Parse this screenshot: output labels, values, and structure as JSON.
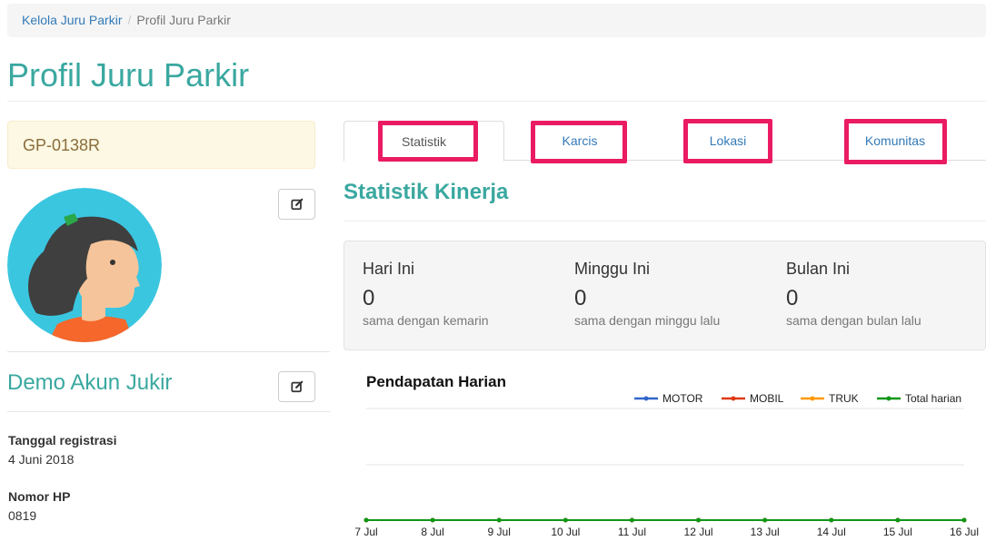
{
  "breadcrumb": {
    "parent": "Kelola Juru Parkir",
    "separator": "/",
    "current": "Profil Juru Parkir"
  },
  "page": {
    "title": "Profil Juru Parkir"
  },
  "profile": {
    "code": "GP-0138R",
    "name": "Demo Akun Jukir",
    "fields": [
      {
        "label": "Tanggal registrasi",
        "value": "4 Juni 2018"
      },
      {
        "label": "Nomor HP",
        "value": "0819"
      }
    ]
  },
  "tabs": [
    {
      "label": "Statistik",
      "active": true
    },
    {
      "label": "Karcis",
      "active": false
    },
    {
      "label": "Lokasi",
      "active": false
    },
    {
      "label": "Komunitas",
      "active": false
    }
  ],
  "section": {
    "title": "Statistik Kinerja"
  },
  "stats": [
    {
      "label": "Hari Ini",
      "value": "0",
      "note": "sama dengan kemarin"
    },
    {
      "label": "Minggu Ini",
      "value": "0",
      "note": "sama dengan minggu lalu"
    },
    {
      "label": "Bulan Ini",
      "value": "0",
      "note": "sama dengan bulan lalu"
    }
  ],
  "colors": {
    "accent": "#3aa8a0",
    "highlight": "#ea1b63",
    "link": "#337ab7"
  },
  "icons": {
    "edit": "edit-icon",
    "avatar": "avatar-illustration"
  },
  "chart_data": {
    "type": "line",
    "title": "Pendapatan Harian",
    "categories": [
      "7 Jul",
      "8 Jul",
      "9 Jul",
      "10 Jul",
      "11 Jul",
      "12 Jul",
      "13 Jul",
      "14 Jul",
      "15 Jul",
      "16 Jul"
    ],
    "series": [
      {
        "name": "MOTOR",
        "color": "#3366cc",
        "values": [
          0,
          0,
          0,
          0,
          0,
          0,
          0,
          0,
          0,
          0
        ]
      },
      {
        "name": "MOBIL",
        "color": "#dc3912",
        "values": [
          0,
          0,
          0,
          0,
          0,
          0,
          0,
          0,
          0,
          0
        ]
      },
      {
        "name": "TRUK",
        "color": "#ff9900",
        "values": [
          0,
          0,
          0,
          0,
          0,
          0,
          0,
          0,
          0,
          0
        ]
      },
      {
        "name": "Total harian",
        "color": "#109618",
        "values": [
          0,
          0,
          0,
          0,
          0,
          0,
          0,
          0,
          0,
          0
        ]
      }
    ],
    "legend": "top-right",
    "grid": true
  }
}
